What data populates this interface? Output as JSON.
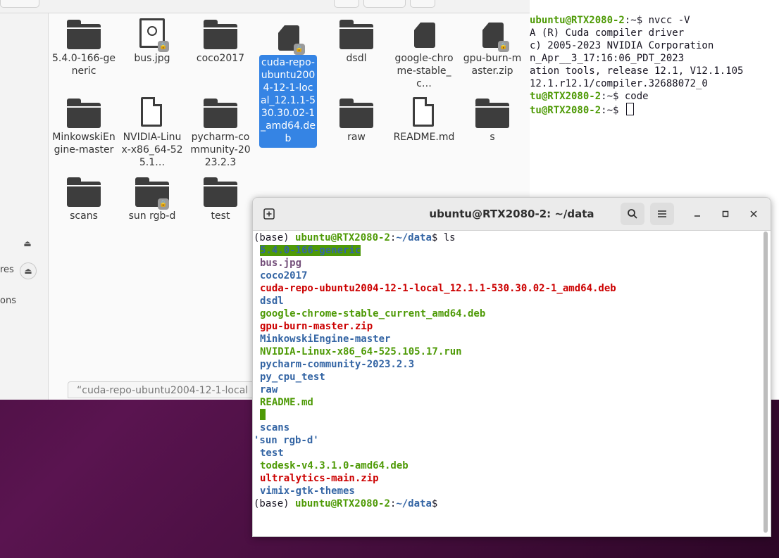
{
  "files": {
    "sidebar": {
      "row1_label": "",
      "row2_label": "res",
      "row3_label": "ons",
      "eject_glyph": "⏏"
    },
    "items": [
      {
        "label": "5.4.0-166-generic",
        "icon": "folder-icon"
      },
      {
        "label": "bus.jpg",
        "icon": "image-icon",
        "locked": true
      },
      {
        "label": "coco2017",
        "icon": "folder-icon"
      },
      {
        "label": "cuda-repo-ubuntu2004-12-1-local_12.1.1-530.30.02-1_amd64.deb",
        "icon": "package-icon",
        "locked": true,
        "selected": true
      },
      {
        "label": "dsdl",
        "icon": "folder-icon"
      },
      {
        "label": "google-chrome-stable_c…",
        "icon": "package-icon"
      },
      {
        "label": "gpu-burn-master.zip",
        "icon": "package-icon",
        "locked": true
      },
      {
        "label": "MinkowskiEngine-master",
        "icon": "folder-icon"
      },
      {
        "label": "NVIDIA-Linux-x86_64-525.1…",
        "icon": "document-icon"
      },
      {
        "label": "pycharm-community-2023.2.3",
        "icon": "folder-icon"
      },
      {
        "label": "raw",
        "icon": "folder-icon"
      },
      {
        "label": "README.md",
        "icon": "document-icon"
      },
      {
        "label": "s",
        "icon": "folder-icon"
      },
      {
        "label": "scans",
        "icon": "folder-icon"
      },
      {
        "label": "sun rgb-d",
        "icon": "folder-icon",
        "locked": true
      },
      {
        "label": "test",
        "icon": "folder-icon"
      }
    ],
    "status": "“cuda-repo-ubuntu2004-12-1-local"
  },
  "bg_terminal": {
    "prompt_user": "ubuntu@RTX2080-2",
    "lines": [
      {
        "prompt": "ubuntu@RTX2080-2",
        "path": ":~$ ",
        "cmd": "nvcc -V"
      },
      {
        "text": "A (R) Cuda compiler driver"
      },
      {
        "text": "c) 2005-2023 NVIDIA Corporation"
      },
      {
        "text": "n_Apr__3_17:16:06_PDT_2023"
      },
      {
        "text": "ation tools, release 12.1, V12.1.105"
      },
      {
        "text": "12.1.r12.1/compiler.32688072_0"
      },
      {
        "prompt": "tu@RTX2080-2",
        "path": ":~$ ",
        "cmd": "code"
      },
      {
        "prompt": "tu@RTX2080-2",
        "path": ":~$ ",
        "cmd": ""
      }
    ]
  },
  "fg_terminal": {
    "title": "ubuntu@RTX2080-2: ~/data",
    "prompt_prefix": "(base) ",
    "prompt_user": "ubuntu@RTX2080-2",
    "prompt_sep": ":",
    "prompt_path": "~/data",
    "prompt_end": "$",
    "command": " ls",
    "entries": [
      {
        "name": "5.4.0-166-generic",
        "kind": "dir-highlight"
      },
      {
        "name": "bus.jpg",
        "kind": "img"
      },
      {
        "name": "coco2017",
        "kind": "dir"
      },
      {
        "name": "cuda-repo-ubuntu2004-12-1-local_12.1.1-530.30.02-1_amd64.deb",
        "kind": "arch"
      },
      {
        "name": "dsdl",
        "kind": "dir"
      },
      {
        "name": "google-chrome-stable_current_amd64.deb",
        "kind": "exec"
      },
      {
        "name": "gpu-burn-master.zip",
        "kind": "arch"
      },
      {
        "name": "MinkowskiEngine-master",
        "kind": "dir"
      },
      {
        "name": "NVIDIA-Linux-x86_64-525.105.17.run",
        "kind": "exec"
      },
      {
        "name": "pycharm-community-2023.2.3",
        "kind": "dir"
      },
      {
        "name": "py_cpu_test",
        "kind": "dir"
      },
      {
        "name": "raw",
        "kind": "dir"
      },
      {
        "name": "README.md",
        "kind": "exec"
      },
      {
        "name": "",
        "kind": "box"
      },
      {
        "name": "scans",
        "kind": "dir"
      },
      {
        "name": "'sun rgb-d'",
        "kind": "dir-quoted"
      },
      {
        "name": "test",
        "kind": "dir"
      },
      {
        "name": "todesk-v4.3.1.0-amd64.deb",
        "kind": "exec"
      },
      {
        "name": "ultralytics-main.zip",
        "kind": "arch"
      },
      {
        "name": "vimix-gtk-themes",
        "kind": "dir"
      }
    ],
    "buttons": {
      "new_tab": "⊞",
      "search": "search",
      "menu": "menu",
      "minimize": "–",
      "maximize": "□",
      "close": "✕"
    }
  }
}
